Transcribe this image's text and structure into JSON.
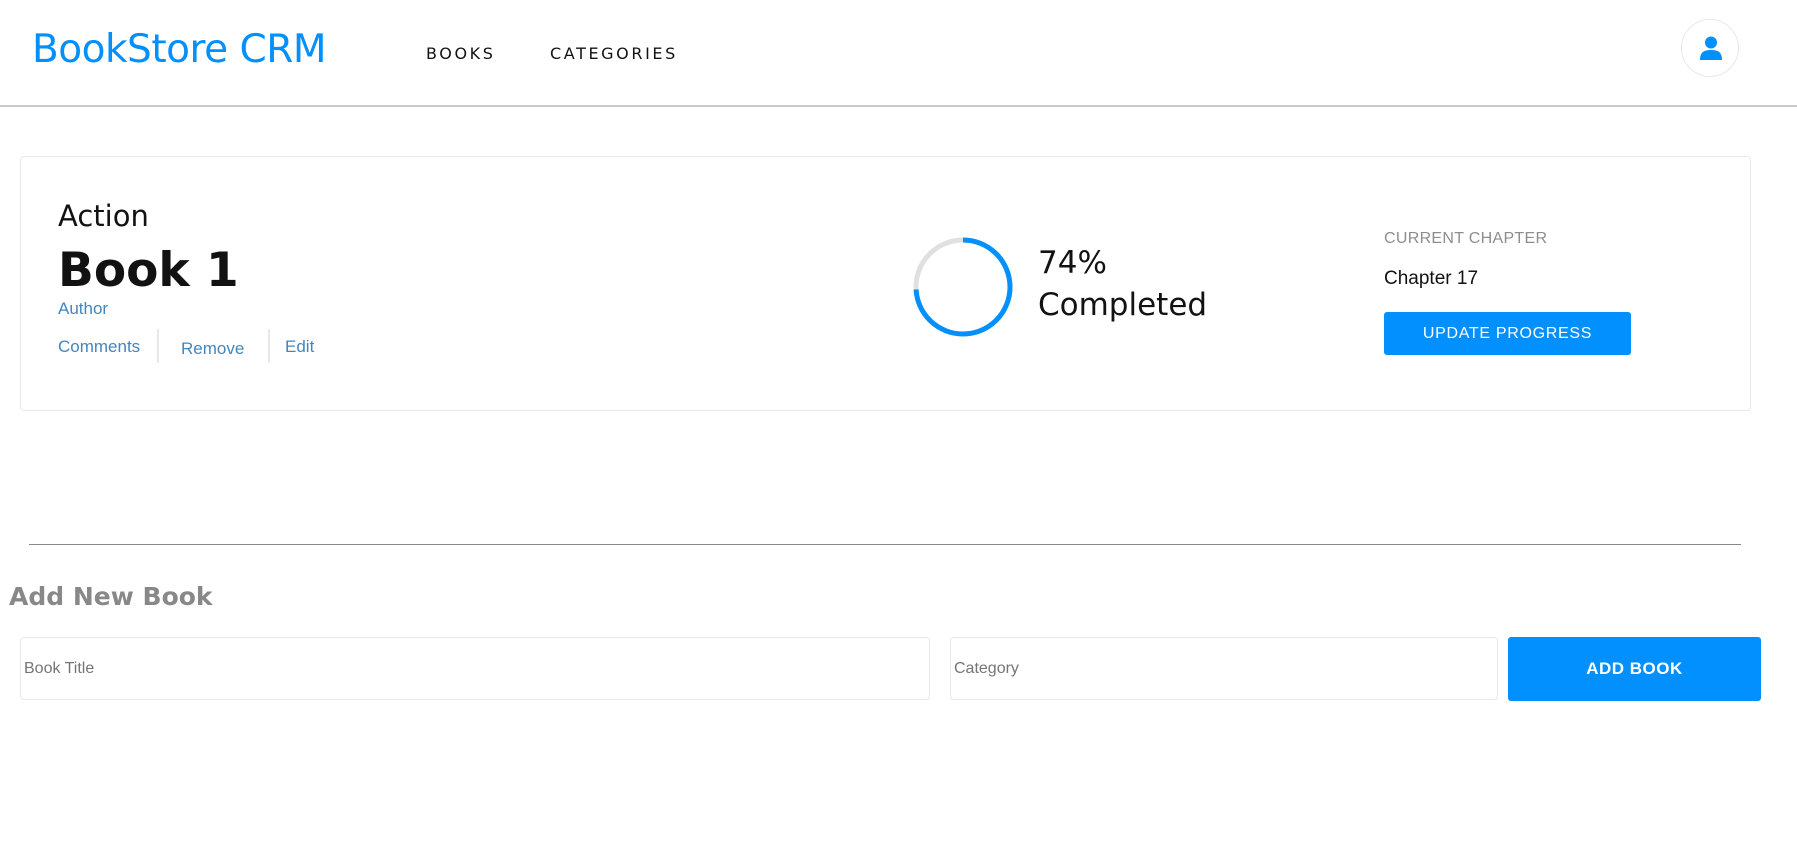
{
  "header": {
    "brand": "BookStore CRM",
    "nav": [
      {
        "label": "BOOKS"
      },
      {
        "label": "CATEGORIES"
      }
    ],
    "avatar_icon": "user-icon"
  },
  "book": {
    "category": "Action",
    "title": "Book 1",
    "author": "Author",
    "actions": {
      "comments": "Comments",
      "remove": "Remove",
      "edit": "Edit"
    },
    "progress": {
      "percent": 74,
      "percent_label": "74%",
      "status_label": "Completed"
    },
    "chapter": {
      "heading": "CURRENT CHAPTER",
      "value": "Chapter 17",
      "update_label": "UPDATE PROGRESS"
    }
  },
  "form": {
    "title": "Add New Book",
    "title_placeholder": "Book Title",
    "category_placeholder": "Category",
    "submit_label": "ADD BOOK"
  },
  "colors": {
    "accent": "#0290ff",
    "link": "#4386bf",
    "ring_track": "#e0e0e0"
  }
}
